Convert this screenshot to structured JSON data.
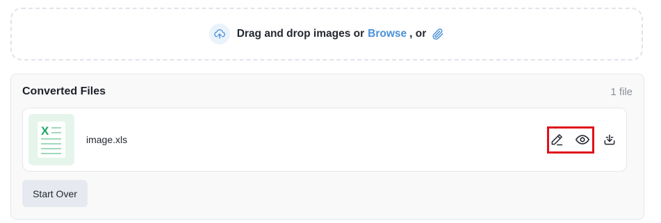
{
  "upload": {
    "drag_text": "Drag and drop images or",
    "browse_label": "Browse",
    "or_text": ", or"
  },
  "converted": {
    "title": "Converted Files",
    "count": "1 file",
    "files": [
      {
        "name": "image.xls",
        "thumb_letter": "X"
      }
    ]
  },
  "actions": {
    "start_over_label": "Start Over"
  },
  "colors": {
    "accent": "#4a90d9",
    "excel_green": "#1fa463",
    "highlight": "#e0101a"
  },
  "icons": {
    "upload": "cloud-upload-icon",
    "attach": "paperclip-icon",
    "edit": "pencil-icon",
    "preview": "eye-icon",
    "download": "download-icon"
  }
}
